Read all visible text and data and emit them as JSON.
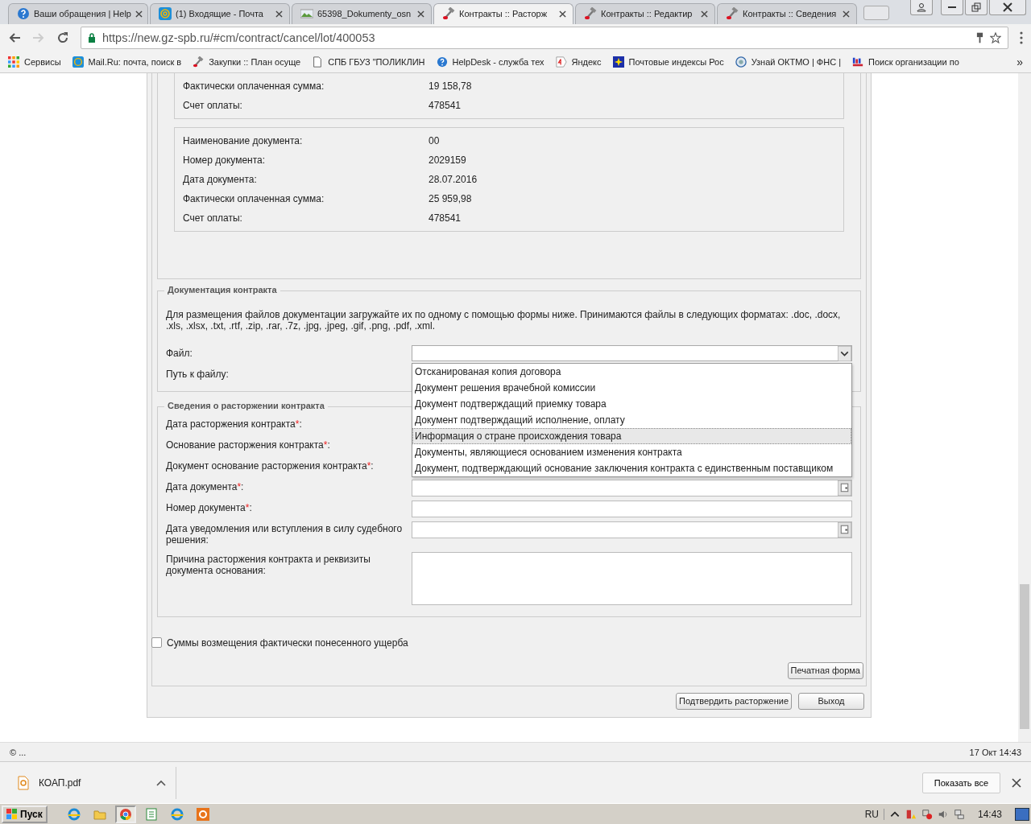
{
  "browser": {
    "tabs": [
      {
        "title": "Ваши обращения | Help",
        "kind": "help",
        "selected": false
      },
      {
        "title": "(1) Входящие - Почта",
        "kind": "mail",
        "selected": false
      },
      {
        "title": "65398_Dokumenty_osn",
        "kind": "image",
        "selected": false
      },
      {
        "title": "Контракты :: Расторж",
        "kind": "tool",
        "selected": true
      },
      {
        "title": "Контракты :: Редактир",
        "kind": "tool",
        "selected": false
      },
      {
        "title": "Контракты :: Сведения",
        "kind": "tool",
        "selected": false
      }
    ],
    "address": "https://new.gz-spb.ru/#cm/contract/cancel/lot/400053",
    "bookmarks": [
      {
        "label": "Сервисы",
        "kind": "apps"
      },
      {
        "label": "Mail.Ru: почта, поиск в",
        "kind": "mail"
      },
      {
        "label": "Закупки :: План осуще",
        "kind": "tool"
      },
      {
        "label": "СПБ ГБУЗ \"ПОЛИКЛИН",
        "kind": "page"
      },
      {
        "label": "HelpDesk - служба тех",
        "kind": "help"
      },
      {
        "label": "Яндекс",
        "kind": "yandex"
      },
      {
        "label": "Почтовые индексы Рос",
        "kind": "post"
      },
      {
        "label": "Узнай ОКТМО | ФНС |",
        "kind": "fns"
      },
      {
        "label": "Поиск организации по",
        "kind": "list"
      }
    ],
    "bookmarks_overflow": "»"
  },
  "page": {
    "payment_blocks": [
      {
        "cut": true,
        "rows": [
          {
            "label": "Фактически оплаченная сумма:",
            "value": "19 158,78"
          },
          {
            "label": "Счет оплаты:",
            "value": "478541"
          }
        ]
      },
      {
        "cut": false,
        "rows": [
          {
            "label": "Наименование документа:",
            "value": "00"
          },
          {
            "label": "Номер документа:",
            "value": "2029159"
          },
          {
            "label": "Дата документа:",
            "value": "28.07.2016"
          },
          {
            "label": "Фактически оплаченная сумма:",
            "value": "25 959,98"
          },
          {
            "label": "Счет оплаты:",
            "value": "478541"
          }
        ]
      }
    ],
    "documentation": {
      "title": "Документация контракта",
      "description": "Для размещения файлов документации загружайте их по одному с помощью формы ниже. Принимаются файлы в следующих форматах: .doc, .docx, .xls, .xlsx, .txt, .rtf, .zip, .rar, .7z, .jpg, .jpeg, .gif, .png, .pdf, .xml.",
      "file_label": "Файл:",
      "path_label": "Путь к файлу:",
      "dropdown_open": true,
      "options": [
        {
          "label": "Отсканированая копия договора",
          "highlighted": false
        },
        {
          "label": "Документ решения врачебной комиссии",
          "highlighted": false
        },
        {
          "label": "Документ подтверждащий приемку товара",
          "highlighted": false
        },
        {
          "label": "Документ подтверждащий исполнение, оплату",
          "highlighted": false
        },
        {
          "label": "Информация о стране происхождения товара",
          "highlighted": true
        },
        {
          "label": "Документы, являющиеся основанием изменения контракта",
          "highlighted": false
        },
        {
          "label": "Документ, подтверждающий основание заключения контракта с единственным поставщиком",
          "highlighted": false
        }
      ]
    },
    "termination": {
      "title": "Сведения о расторжении контракта",
      "rows": [
        {
          "label": "Дата расторжения контракта",
          "mark": "*",
          "tail": ":"
        },
        {
          "label": "Основание расторжения контракта",
          "mark": "*",
          "tail": ":"
        },
        {
          "label": "Документ основание расторжения контракта",
          "mark": "*",
          "tail": ":"
        },
        {
          "label": "Дата документа",
          "mark": "*",
          "tail": ":",
          "kind": "date"
        },
        {
          "label": "Номер документа",
          "mark": "*",
          "tail": ":",
          "kind": "text"
        },
        {
          "label": "Дата уведомления или вступления в силу судебного решения:",
          "kind": "date"
        },
        {
          "label": "Причина расторжения контракта и реквизиты документа основания:",
          "kind": "textarea"
        }
      ]
    },
    "damages_checkbox": {
      "label": "Суммы возмещения фактически понесенного ущерба",
      "checked": false
    },
    "print_button": "Печатная форма",
    "buttons": [
      "Подтвердить расторжение",
      "Выход"
    ]
  },
  "status_bar": {
    "left": "© ...",
    "right": "17 Окт 14:43"
  },
  "downloads": {
    "file": "КОАП.pdf",
    "show_all": "Показать все"
  },
  "taskbar": {
    "start": "Пуск",
    "apps": [
      {
        "kind": "ie",
        "selected": false
      },
      {
        "kind": "folder",
        "selected": false
      },
      {
        "kind": "chrome",
        "selected": true
      },
      {
        "kind": "sheet",
        "selected": false
      },
      {
        "kind": "ie",
        "selected": false
      },
      {
        "kind": "reader",
        "selected": false
      }
    ],
    "language": "RU",
    "clock": "14:43"
  }
}
